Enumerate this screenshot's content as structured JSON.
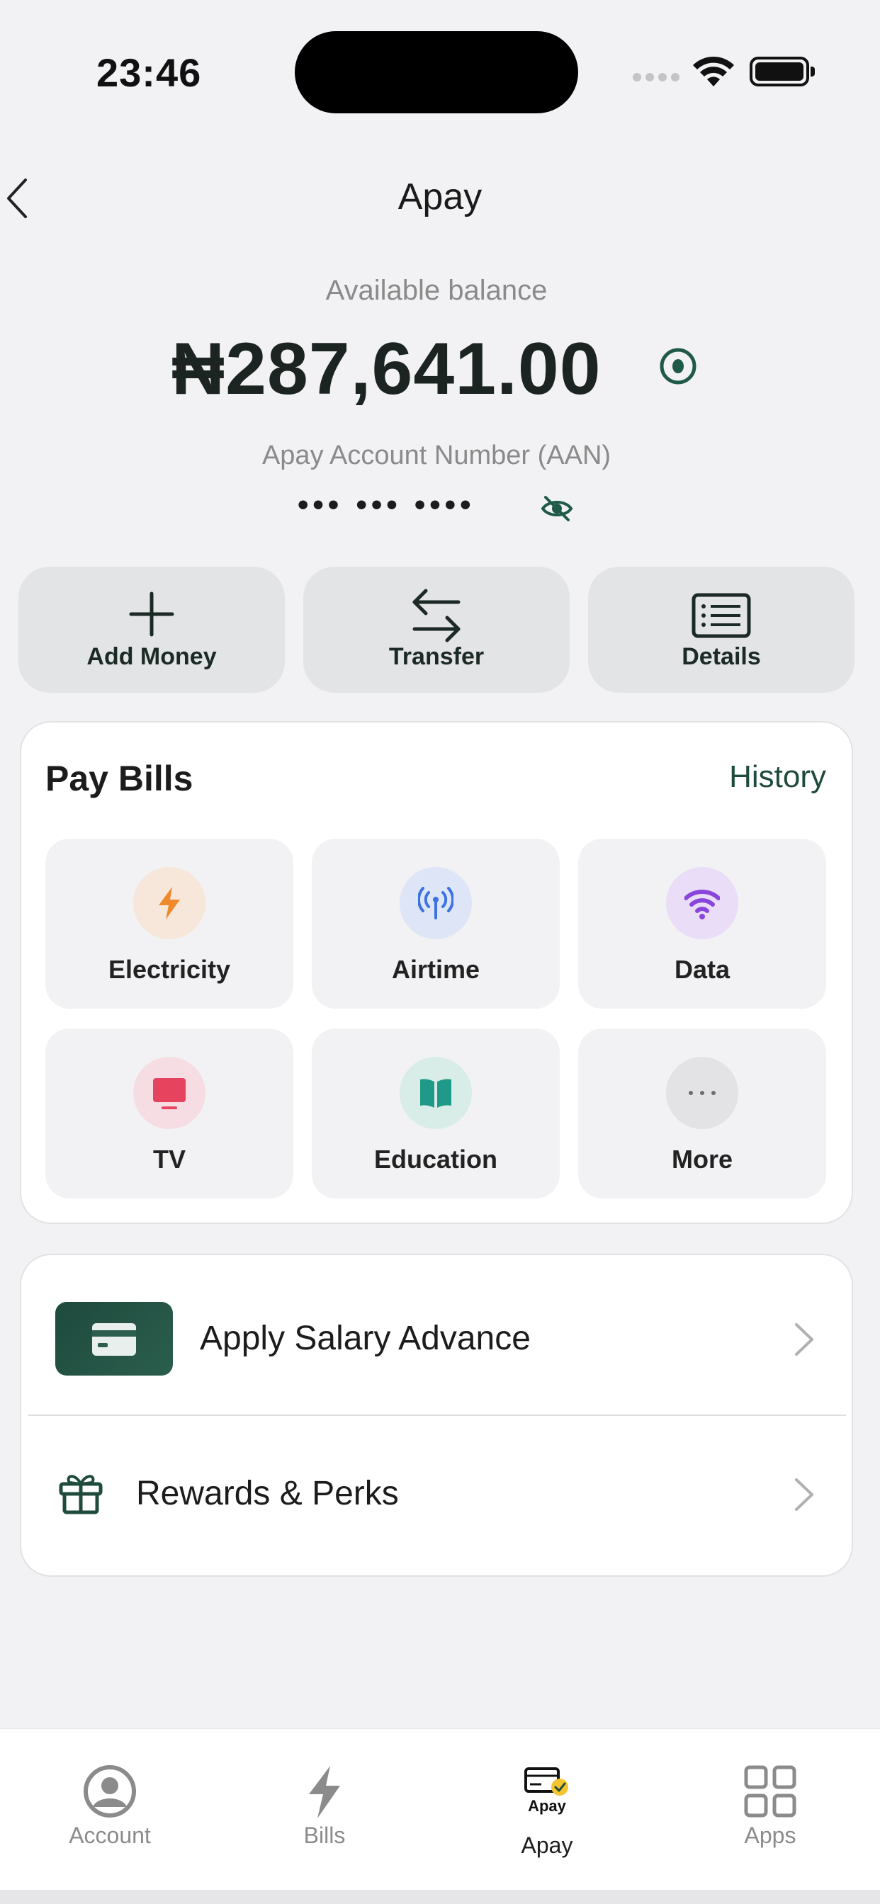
{
  "status_bar": {
    "time": "23:46"
  },
  "header": {
    "title": "Apay",
    "back_icon": "chevron-left-icon"
  },
  "balance": {
    "label": "Available balance",
    "amount": "₦287,641.00",
    "aan_label": "Apay Account Number (AAN)",
    "aan_value": "••• ••• ••••"
  },
  "actions": [
    {
      "label": "Add Money",
      "icon": "plus-icon"
    },
    {
      "label": "Transfer",
      "icon": "transfer-arrows-icon"
    },
    {
      "label": "Details",
      "icon": "list-card-icon"
    }
  ],
  "pay_bills": {
    "title": "Pay Bills",
    "history_label": "History",
    "items": [
      {
        "label": "Electricity",
        "icon": "lightning-icon",
        "color": "#f0892b",
        "bg": "#f6e7da"
      },
      {
        "label": "Airtime",
        "icon": "antenna-icon",
        "color": "#3d73e0",
        "bg": "#dde5f7"
      },
      {
        "label": "Data",
        "icon": "wifi-icon",
        "color": "#8a45dc",
        "bg": "#e9ddf7"
      },
      {
        "label": "TV",
        "icon": "tv-icon",
        "color": "#e6445e",
        "bg": "#f6dde3"
      },
      {
        "label": "Education",
        "icon": "book-icon",
        "color": "#1f9a88",
        "bg": "#d8ece8"
      },
      {
        "label": "More",
        "icon": "more-dots-icon",
        "color": "#6d6d6d",
        "bg": "#e3e3e5"
      }
    ]
  },
  "list": {
    "salary_advance": "Apply Salary Advance",
    "rewards": "Rewards & Perks"
  },
  "tab_bar": {
    "tabs": [
      {
        "label": "Account",
        "icon": "account-icon",
        "active": false
      },
      {
        "label": "Bills",
        "icon": "bolt-icon",
        "active": false
      },
      {
        "label": "Apay",
        "icon": "apay-logo-icon",
        "active": true,
        "logo_text": "Apay"
      },
      {
        "label": "Apps",
        "icon": "apps-grid-icon",
        "active": false
      }
    ]
  },
  "colors": {
    "brand": "#1f4b3d",
    "background": "#f2f2f4"
  }
}
